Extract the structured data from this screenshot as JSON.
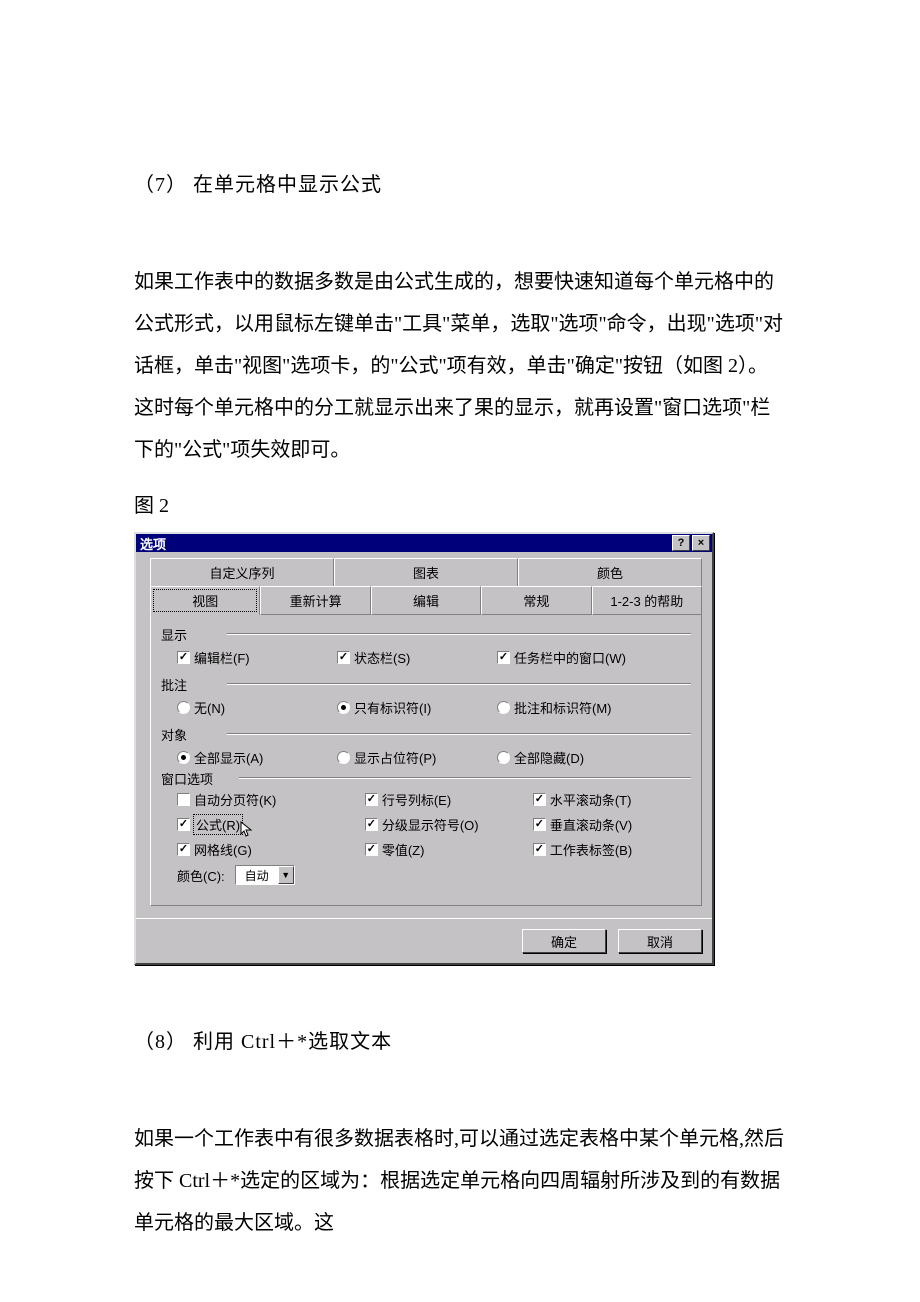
{
  "doc": {
    "heading7": "（7） 在单元格中显示公式",
    "para7": "如果工作表中的数据多数是由公式生成的，想要快速知道每个单元格中的公式形式，以用鼠标左键单击\"工具\"菜单，选取\"选项\"命令，出现\"选项\"对话框，单击\"视图\"选项卡，的\"公式\"项有效，单击\"确定\"按钮（如图 2）。这时每个单元格中的分工就显示出来了果的显示，就再设置\"窗口选项\"栏下的\"公式\"项失效即可。",
    "fig_label": "图 2",
    "heading8": "（8） 利用 Ctrl＋*选取文本",
    "para8": "如果一个工作表中有很多数据表格时,可以通过选定表格中某个单元格,然后按下 Ctrl＋*选定的区域为：根据选定单元格向四周辐射所涉及到的有数据单元格的最大区域。这"
  },
  "dialog": {
    "title": "选项",
    "help_btn": "?",
    "close_btn": "×",
    "tabs_top": [
      "自定义序列",
      "图表",
      "颜色"
    ],
    "tabs_bottom": [
      "视图",
      "重新计算",
      "编辑",
      "常规",
      "1-2-3 的帮助"
    ],
    "group_display": "显示",
    "cb_formula_bar": "编辑栏(F)",
    "cb_status_bar": "状态栏(S)",
    "cb_taskbar_windows": "任务栏中的窗口(W)",
    "group_comments": "批注",
    "rb_none": "无(N)",
    "rb_indicator": "只有标识符(I)",
    "rb_comment_ind": "批注和标识符(M)",
    "group_objects": "对象",
    "rb_show_all": "全部显示(A)",
    "rb_placeholders": "显示占位符(P)",
    "rb_hide_all": "全部隐藏(D)",
    "group_window": "窗口选项",
    "cb_page_breaks": "自动分页符(K)",
    "cb_formulas": "公式(R)",
    "cb_gridlines": "网格线(G)",
    "cb_row_col_headers": "行号列标(E)",
    "cb_outline_symbols": "分级显示符号(O)",
    "cb_zero_values": "零值(Z)",
    "cb_hscroll": "水平滚动条(T)",
    "cb_vscroll": "垂直滚动条(V)",
    "cb_sheet_tabs": "工作表标签(B)",
    "color_label": "颜色(C):",
    "color_value": "自动",
    "btn_ok": "确定",
    "btn_cancel": "取消"
  }
}
